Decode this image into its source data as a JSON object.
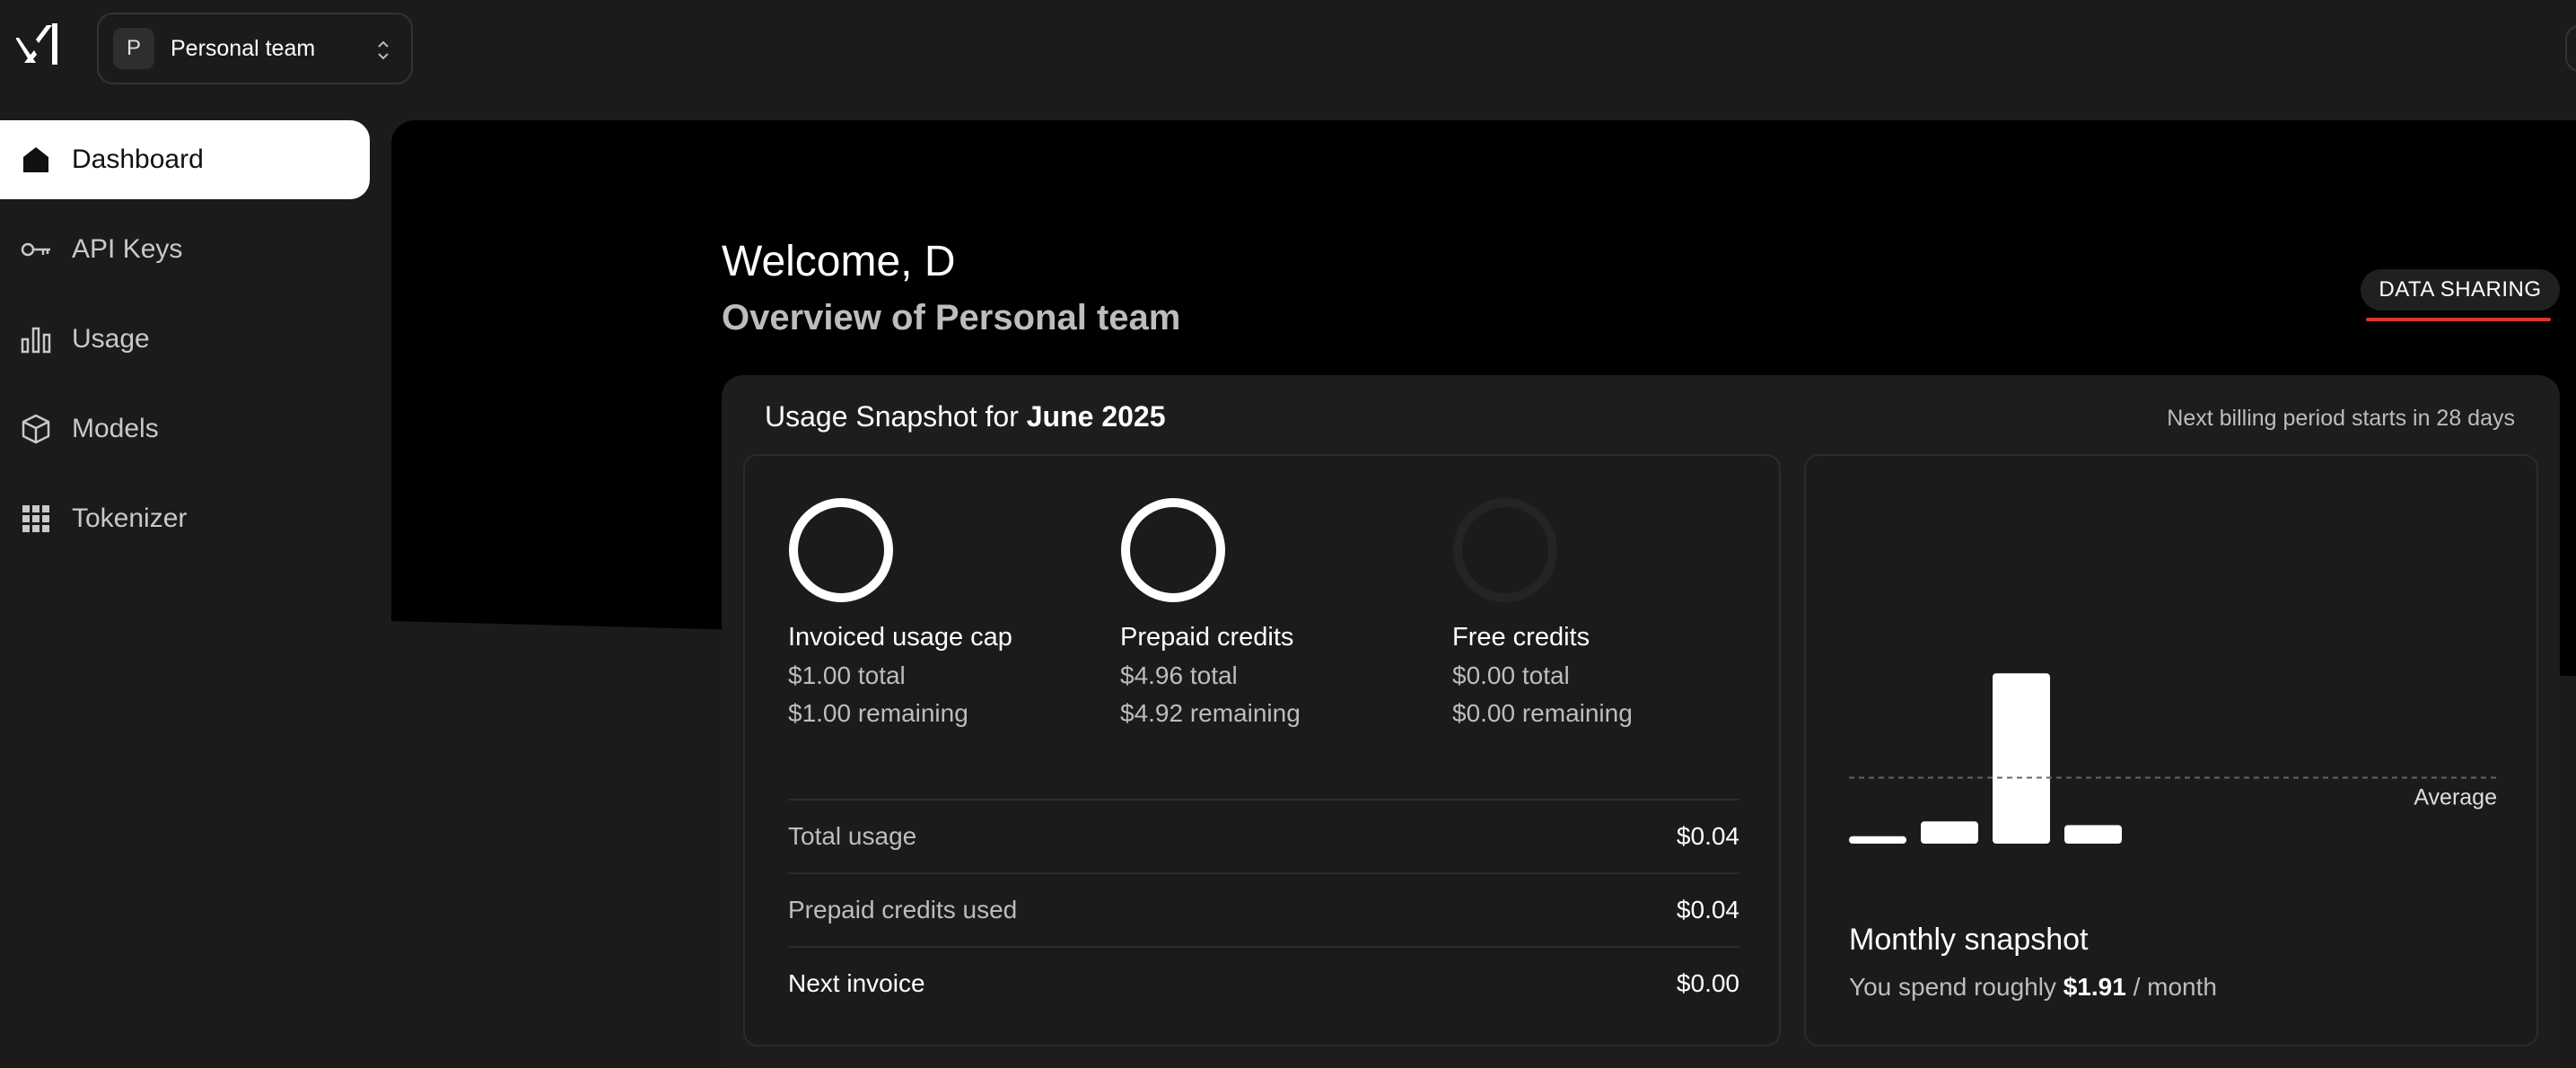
{
  "app": {
    "logo_icon": "xai-logo-icon"
  },
  "team": {
    "avatar_letter": "P",
    "name": "Personal team"
  },
  "sidebar": {
    "items": [
      {
        "label": "Dashboard",
        "icon": "home-icon",
        "active": true
      },
      {
        "label": "API Keys",
        "icon": "key-icon"
      },
      {
        "label": "Usage",
        "icon": "bar-chart-icon"
      },
      {
        "label": "Models",
        "icon": "cube-icon"
      },
      {
        "label": "Tokenizer",
        "icon": "grid-icon"
      }
    ]
  },
  "header": {
    "welcome": "Welcome, D",
    "overview": "Overview of Personal team",
    "data_sharing": "DATA SHARING"
  },
  "snapshot": {
    "title_prefix": "Usage Snapshot for",
    "period": "June 2025",
    "billing_note": "Next billing period starts in 28 days",
    "metrics": [
      {
        "label": "Invoiced usage cap",
        "total": "$1.00 total",
        "remaining": "$1.00 remaining",
        "ring_fill": 1.0
      },
      {
        "label": "Prepaid credits",
        "total": "$4.96 total",
        "remaining": "$4.92 remaining",
        "ring_fill": 1.0
      },
      {
        "label": "Free credits",
        "total": "$0.00 total",
        "remaining": "$0.00 remaining",
        "ring_fill": 0.0
      }
    ],
    "summary": [
      {
        "label": "Total usage",
        "value": "$0.04"
      },
      {
        "label": "Prepaid credits used",
        "value": "$0.04"
      },
      {
        "label": "Next invoice",
        "value": "$0.00"
      }
    ]
  },
  "monthly": {
    "title": "Monthly snapshot",
    "sub_prefix": "You spend roughly",
    "amount": "$1.91",
    "sub_suffix": "/ month"
  },
  "chart_data": {
    "type": "bar",
    "categories": [
      "",
      "",
      "",
      ""
    ],
    "values": [
      0.1,
      0.3,
      2.3,
      0.25
    ],
    "average": 0.6,
    "annotations": [
      "Average"
    ],
    "ylim": [
      0,
      2.4
    ],
    "grid": false
  },
  "colors": {
    "accent_red": "#e0352b",
    "bar": "#ffffff",
    "muted_ring": "#2a2a2a"
  }
}
